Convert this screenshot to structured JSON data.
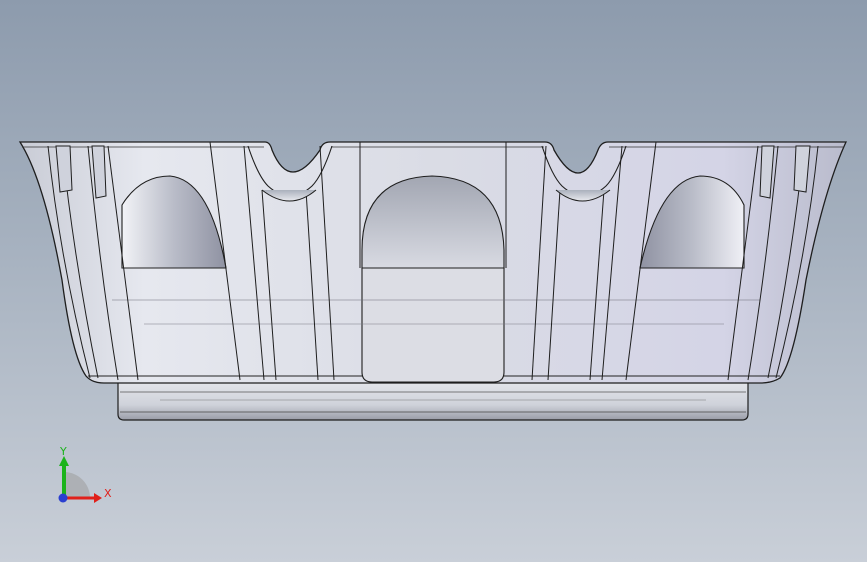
{
  "viewport": {
    "background_top": "#8d9bad",
    "background_bottom": "#c9cfd8"
  },
  "model": {
    "body_color": "#d6d9e4",
    "edge_color": "#1e1e1e",
    "shadow_color": "#8e8f9c"
  },
  "triad": {
    "x_label": "X",
    "y_label": "Y",
    "x_color": "#e0201a",
    "y_color": "#1bb31b",
    "z_color": "#2a3fd0"
  }
}
